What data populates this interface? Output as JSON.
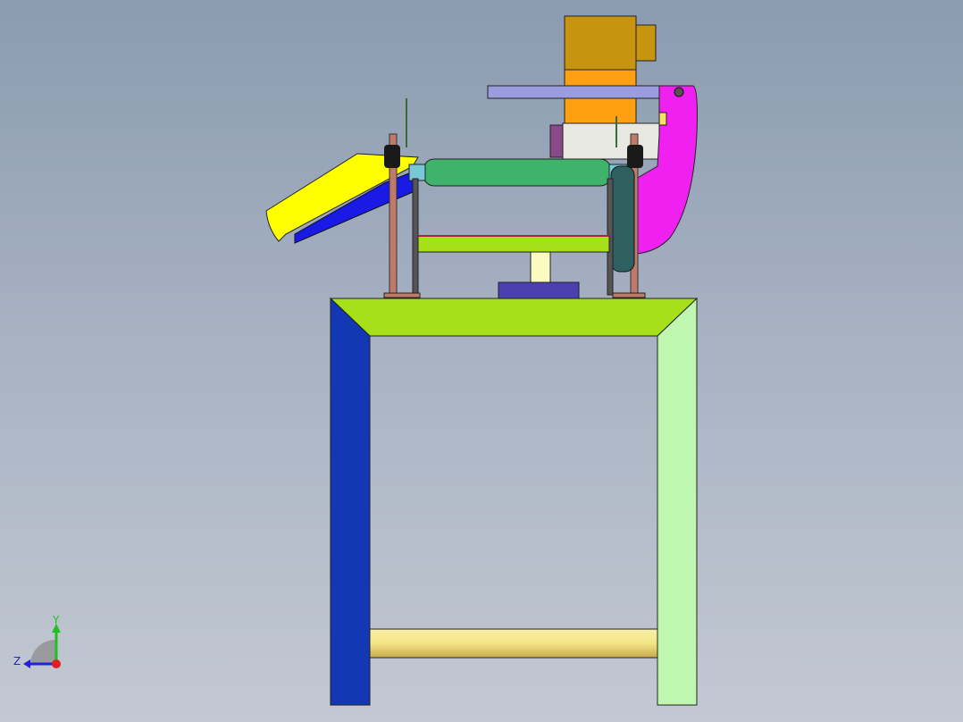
{
  "viewport": {
    "background_top": "#8b9bb0",
    "background_bottom": "#c3c9d2"
  },
  "colors": {
    "frame_top": "#a6e018",
    "frame_left_leg": "#1238b4",
    "frame_right_leg": "#bff7b0",
    "crossbar": "#f4e585",
    "hopper": "#ffff00",
    "hopper_inner": "#1a1ae6",
    "roller": "#3fb36a",
    "motor_top": "#c79410",
    "motor_body": "#ff9f12",
    "gearbox": "#e8e8e2",
    "magenta_part": "#f020f0",
    "lavender_arm": "#9a9ce0",
    "plate": "#a6e018",
    "rod": "#c07a6a",
    "knob": "#1a1a1a",
    "pulley": "#2f6060",
    "base_block": "#4a40b0",
    "support": "#fbfbc0"
  },
  "axis_triad": {
    "y_label": "Y",
    "z_label": "Z",
    "y_color": "#20c020",
    "z_color": "#2020e0",
    "origin_color": "#e02020"
  }
}
